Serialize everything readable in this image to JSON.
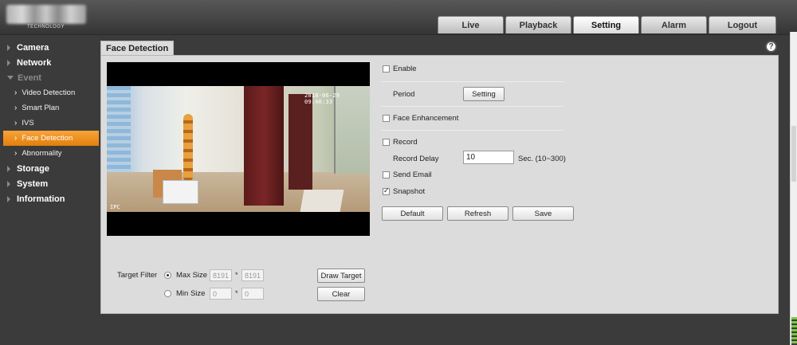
{
  "header": {
    "logo_subtext": "TECHNOLOGY",
    "tabs": [
      {
        "label": "Live",
        "active": false
      },
      {
        "label": "Playback",
        "active": false
      },
      {
        "label": "Setting",
        "active": true
      },
      {
        "label": "Alarm",
        "active": false
      },
      {
        "label": "Logout",
        "active": false
      }
    ]
  },
  "sidebar": {
    "camera": "Camera",
    "network": "Network",
    "event": "Event",
    "event_items": [
      "Video Detection",
      "Smart Plan",
      "IVS",
      "Face Detection",
      "Abnormality"
    ],
    "active_item": "Face Detection",
    "storage": "Storage",
    "system": "System",
    "information": "Information"
  },
  "panel": {
    "title": "Face Detection",
    "help_icon": "?"
  },
  "video": {
    "osd_time": "2018-06-29 09:40:33",
    "osd_name": "IPC"
  },
  "target_filter": {
    "label": "Target Filter",
    "max_size_label": "Max Size",
    "max_w": "8191",
    "max_h": "8191",
    "min_size_label": "Min Size",
    "min_w": "0",
    "min_h": "0",
    "separator": "*",
    "draw_target": "Draw Target",
    "clear": "Clear",
    "selected": "max"
  },
  "settings": {
    "enable": {
      "label": "Enable",
      "checked": false
    },
    "period_label": "Period",
    "period_button": "Setting",
    "face_enhancement": {
      "label": "Face Enhancement",
      "checked": false
    },
    "record": {
      "label": "Record",
      "checked": false
    },
    "record_delay_label": "Record Delay",
    "record_delay_value": "10",
    "record_delay_unit": "Sec. (10~300)",
    "send_email": {
      "label": "Send Email",
      "checked": false
    },
    "snapshot": {
      "label": "Snapshot",
      "checked": true
    },
    "buttons": {
      "default": "Default",
      "refresh": "Refresh",
      "save": "Save"
    }
  }
}
